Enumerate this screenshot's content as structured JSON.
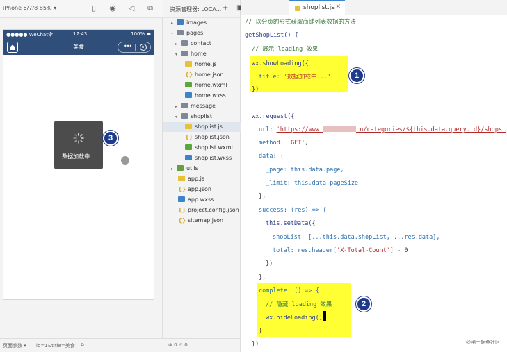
{
  "simulator": {
    "device": "iPhone 6/7/8 85% ▾",
    "status_carrier": "●●●●● WeChat令",
    "status_time": "17:43",
    "status_battery": "100% ▬",
    "nav_title": "美食",
    "capsule_more": "•••",
    "toast_text": "数据加载中...",
    "footer_label": "页面参数 ▾",
    "footer_params": "id=1&title=美食"
  },
  "explorer": {
    "title": "资源管理器: LOCA...",
    "footer": "⊗ 0 ⚠ 0",
    "tree": [
      {
        "label": "images",
        "icon": "folder-blue"
      },
      {
        "label": "pages",
        "icon": "folder"
      },
      {
        "label": "contact",
        "icon": "folder"
      },
      {
        "label": "home",
        "icon": "folder"
      },
      {
        "label": "home.js",
        "icon": "js"
      },
      {
        "label": "home.json",
        "icon": "json"
      },
      {
        "label": "home.wxml",
        "icon": "wxml"
      },
      {
        "label": "home.wxss",
        "icon": "wxss"
      },
      {
        "label": "message",
        "icon": "folder"
      },
      {
        "label": "shoplist",
        "icon": "folder"
      },
      {
        "label": "shoplist.js",
        "icon": "js"
      },
      {
        "label": "shoplist.json",
        "icon": "json"
      },
      {
        "label": "shoplist.wxml",
        "icon": "wxml"
      },
      {
        "label": "shoplist.wxss",
        "icon": "wxss"
      },
      {
        "label": "utils",
        "icon": "folder-green"
      },
      {
        "label": "app.js",
        "icon": "js"
      },
      {
        "label": "app.json",
        "icon": "json"
      },
      {
        "label": "app.wxss",
        "icon": "wxss"
      },
      {
        "label": "project.config.json",
        "icon": "json"
      },
      {
        "label": "sitemap.json",
        "icon": "json"
      }
    ]
  },
  "editor": {
    "tab_label": "shoplist.js",
    "lines": {
      "c1": "// 以分页的形式获取商铺列表数据的方法",
      "fn": "getShopList() {",
      "c2": "// 展示 loading 效果",
      "show": "wx.showLoading({",
      "title_key": "title: ",
      "title_val": "'数据加载中...'",
      "close1": "})",
      "req": "wx.request({",
      "url_key": "url: ",
      "url_a": "'https://www.",
      "url_b": "cn/categories/${this.data.query.id}/shops'",
      "url_end": ",",
      "method_key": "method: ",
      "method_val": "'GET'",
      "method_end": ",",
      "data_open": "data: {",
      "page": "_page: this.data.page,",
      "limit": "_limit: this.data.pageSize",
      "data_close": "},",
      "success": "success: (res) => {",
      "setdata": "this.setData({",
      "shoplist": "shopList: [...this.data.shopList, ...res.data],",
      "total_a": "total: res.header[",
      "total_b": "'X-Total-Count'",
      "total_c": "] - 0",
      "close2": "})",
      "close3": "},",
      "complete": "complete: () => {",
      "c3": "// 隐藏 loading 效果",
      "hide": "wx.hideLoading()",
      "close4": "}",
      "close5": "})"
    }
  },
  "annotations": {
    "b1": "1",
    "b2": "2",
    "b3": "3"
  },
  "watermark": "@稀土掘金社区",
  "colors": {
    "highlight": "#ffff33",
    "badge": "#1e3a8a",
    "nav": "#2f4f7a"
  }
}
